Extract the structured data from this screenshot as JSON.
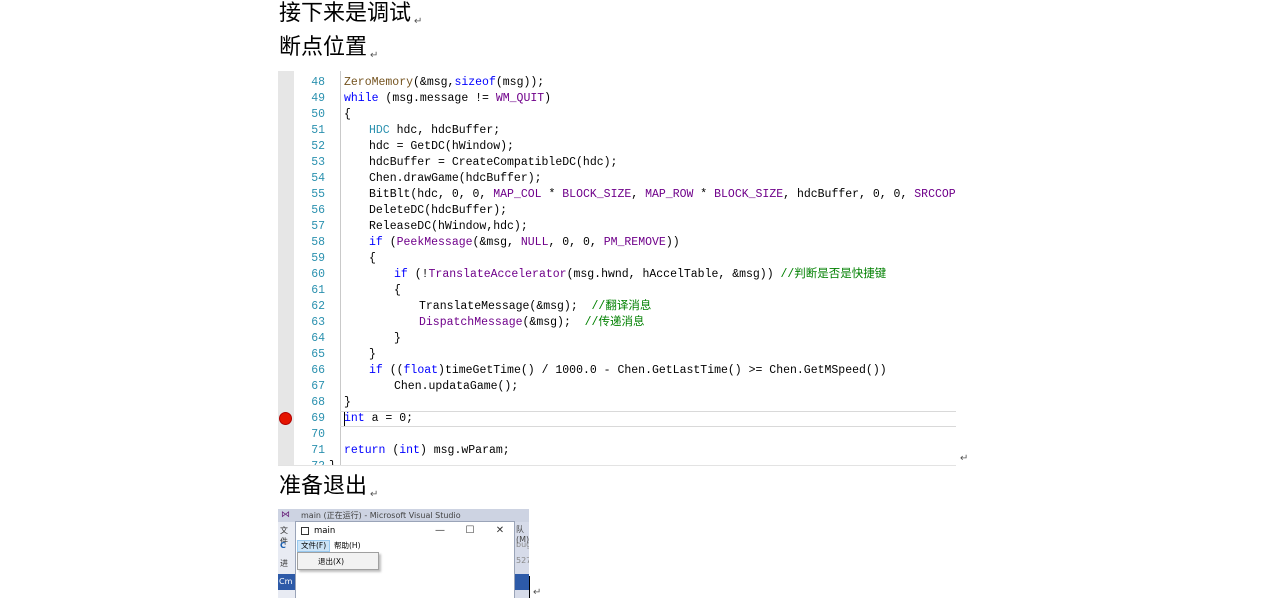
{
  "headings": {
    "debug": "接下来是调试",
    "breakpoint": "断点位置",
    "exit": "准备退出",
    "paragraph_mark": "↵"
  },
  "code": {
    "lines": [
      {
        "n": "48",
        "tokens": [
          [
            "fn",
            "ZeroMemory"
          ],
          [
            "",
            "(&msg,"
          ],
          [
            "kw",
            "sizeof"
          ],
          [
            "",
            "(msg));"
          ]
        ],
        "indent": 0
      },
      {
        "n": "49",
        "tokens": [
          [
            "kw",
            "while"
          ],
          [
            "",
            " (msg.message != "
          ],
          [
            "mac",
            "WM_QUIT"
          ],
          [
            "",
            ")"
          ]
        ],
        "indent": 0
      },
      {
        "n": "50",
        "tokens": [
          [
            "",
            "{"
          ]
        ],
        "indent": 0
      },
      {
        "n": "51",
        "tokens": [
          [
            "typ",
            "HDC"
          ],
          [
            "",
            " hdc, hdcBuffer;"
          ]
        ],
        "indent": 1
      },
      {
        "n": "52",
        "tokens": [
          [
            "",
            "hdc = GetDC(hWindow);"
          ]
        ],
        "indent": 1
      },
      {
        "n": "53",
        "tokens": [
          [
            "",
            "hdcBuffer = CreateCompatibleDC(hdc);"
          ]
        ],
        "indent": 1
      },
      {
        "n": "54",
        "tokens": [
          [
            "",
            "Chen.drawGame(hdcBuffer);"
          ]
        ],
        "indent": 1
      },
      {
        "n": "55",
        "tokens": [
          [
            "",
            "BitBlt(hdc, 0, 0, "
          ],
          [
            "mac",
            "MAP_COL"
          ],
          [
            "",
            " * "
          ],
          [
            "mac",
            "BLOCK_SIZE"
          ],
          [
            "",
            ", "
          ],
          [
            "mac",
            "MAP_ROW"
          ],
          [
            "",
            " * "
          ],
          [
            "mac",
            "BLOCK_SIZE"
          ],
          [
            "",
            ", hdcBuffer, 0, 0, "
          ],
          [
            "mac",
            "SRCCOPY"
          ],
          [
            "",
            ");"
          ]
        ],
        "indent": 1
      },
      {
        "n": "56",
        "tokens": [
          [
            "",
            "DeleteDC(hdcBuffer);"
          ]
        ],
        "indent": 1
      },
      {
        "n": "57",
        "tokens": [
          [
            "",
            "ReleaseDC(hWindow,hdc);"
          ]
        ],
        "indent": 1
      },
      {
        "n": "58",
        "tokens": [
          [
            "kw",
            "if"
          ],
          [
            "",
            " ("
          ],
          [
            "mac",
            "PeekMessage"
          ],
          [
            "",
            "(&msg, "
          ],
          [
            "mac",
            "NULL"
          ],
          [
            "",
            ", 0, 0, "
          ],
          [
            "mac",
            "PM_REMOVE"
          ],
          [
            "",
            "))"
          ]
        ],
        "indent": 1
      },
      {
        "n": "59",
        "tokens": [
          [
            "",
            "{"
          ]
        ],
        "indent": 1
      },
      {
        "n": "60",
        "tokens": [
          [
            "kw",
            "if"
          ],
          [
            "",
            " (!"
          ],
          [
            "mac",
            "TranslateAccelerator"
          ],
          [
            "",
            "(msg.hwnd, hAccelTable, &msg)) "
          ],
          [
            "cmt",
            "//判断是否是快捷键"
          ]
        ],
        "indent": 2
      },
      {
        "n": "61",
        "tokens": [
          [
            "",
            "{"
          ]
        ],
        "indent": 2
      },
      {
        "n": "62",
        "tokens": [
          [
            "",
            "TranslateMessage(&msg);  "
          ],
          [
            "cmt",
            "//翻译消息"
          ]
        ],
        "indent": 3
      },
      {
        "n": "63",
        "tokens": [
          [
            "mac",
            "DispatchMessage"
          ],
          [
            "",
            "(&msg);  "
          ],
          [
            "cmt",
            "//传递消息"
          ]
        ],
        "indent": 3
      },
      {
        "n": "64",
        "tokens": [
          [
            "",
            "}"
          ]
        ],
        "indent": 2
      },
      {
        "n": "65",
        "tokens": [
          [
            "",
            "}"
          ]
        ],
        "indent": 1
      },
      {
        "n": "66",
        "tokens": [
          [
            "kw",
            "if"
          ],
          [
            "",
            " (("
          ],
          [
            "kw",
            "float"
          ],
          [
            "",
            ")timeGetTime() / 1000.0 - Chen.GetLastTime() >= Chen.GetMSpeed())"
          ]
        ],
        "indent": 1
      },
      {
        "n": "67",
        "tokens": [
          [
            "",
            "Chen.updataGame();"
          ]
        ],
        "indent": 2
      },
      {
        "n": "68",
        "tokens": [
          [
            "",
            "}"
          ]
        ],
        "indent": 0
      },
      {
        "n": "69",
        "tokens": [
          [
            "kw",
            "int"
          ],
          [
            "",
            " a = 0;"
          ]
        ],
        "indent": 0,
        "breakpoint": true
      },
      {
        "n": "70",
        "tokens": [],
        "indent": 0
      },
      {
        "n": "71",
        "tokens": [
          [
            "kw",
            "return"
          ],
          [
            "",
            " ("
          ],
          [
            "kw",
            "int"
          ],
          [
            "",
            ") msg.wParam;"
          ]
        ],
        "indent": 0
      },
      {
        "n": "72",
        "tokens": [
          [
            "",
            "}"
          ]
        ],
        "indent": -1
      }
    ]
  },
  "vs": {
    "window_title": "main (正在运行) - Microsoft Visual Studio",
    "left_labels": [
      "文件",
      "C",
      "进"
    ],
    "left_bottom": "Cm",
    "right_labels": [
      "队(M)",
      "bug",
      "527"
    ],
    "app_title": "main",
    "minimize": "—",
    "maximize": "☐",
    "close": "✕",
    "menu_file": "文件(F)",
    "menu_help": "帮助(H)",
    "menu_exit": "退出(X)"
  }
}
